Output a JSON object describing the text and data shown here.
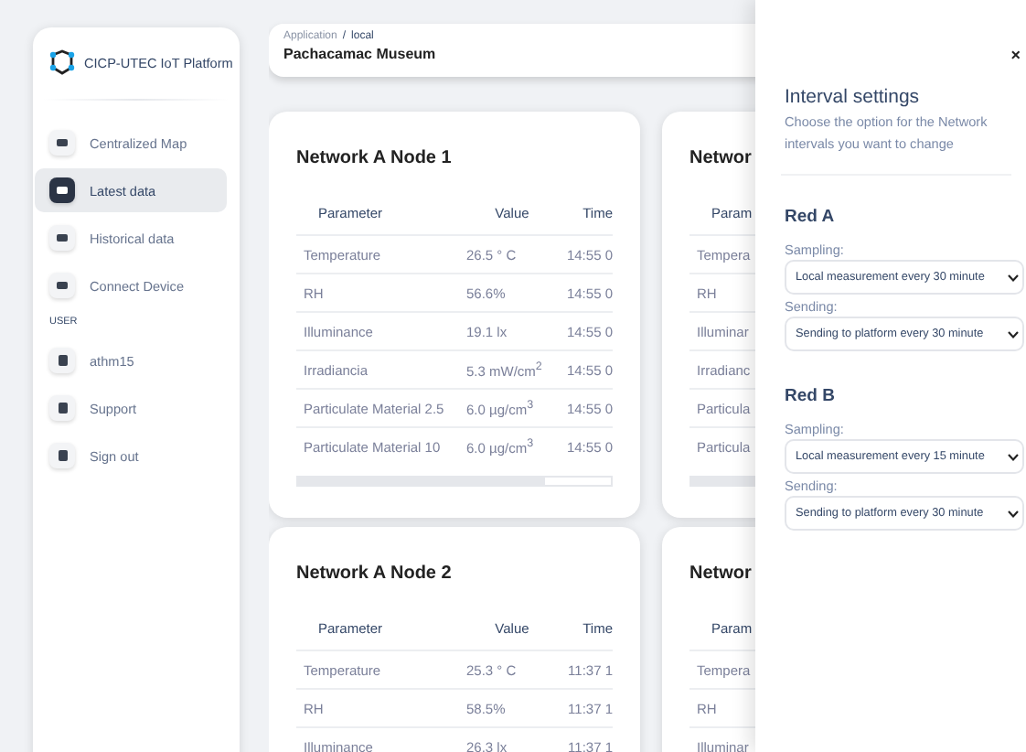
{
  "sidebar": {
    "logo": "CICP-UTEC IoT Platform",
    "nav": [
      {
        "label": "Centralized Map",
        "selected": false
      },
      {
        "label": "Latest data",
        "selected": true
      },
      {
        "label": "Historical data",
        "selected": false
      },
      {
        "label": "Connect Device",
        "selected": false
      }
    ],
    "section_label": "USER",
    "user_items": [
      {
        "label": "athm15"
      },
      {
        "label": "Support"
      },
      {
        "label": "Sign out"
      }
    ]
  },
  "breadcrumb": {
    "path": [
      "Application",
      "local"
    ],
    "separator": "/",
    "title": "Pachacamac Museum"
  },
  "cards": [
    {
      "title": "Network A Node 1",
      "columns": [
        "Parameter",
        "Value",
        "Time"
      ],
      "rows": [
        [
          "Temperature",
          "26.5 ° C",
          "14:55 0"
        ],
        [
          "RH",
          "56.6%",
          "14:55 0"
        ],
        [
          "Illuminance",
          "19.1 lx",
          "14:55 0"
        ],
        [
          "Irradiancia",
          "5.3 mW/cm$^{2}$",
          "14:55 0"
        ],
        [
          "Particulate Material 2.5",
          "6.0 µg/cm$^{3}$",
          "14:55 0"
        ],
        [
          "Particulate Material 10",
          "6.0 µg/cm$^{3}$",
          "14:55 0"
        ]
      ],
      "scrollbar": true
    },
    {
      "title": "Networ",
      "columns": [
        "Param"
      ],
      "rows": [
        [
          "Tempera"
        ],
        [
          "RH"
        ],
        [
          "Illuminar"
        ],
        [
          "Irradianc"
        ],
        [
          "Particula"
        ],
        [
          "Particula"
        ]
      ],
      "scrollbar": true
    },
    {
      "title": "Network A Node 2",
      "columns": [
        "Parameter",
        "Value",
        "Time"
      ],
      "rows": [
        [
          "Temperature",
          "25.3 ° C",
          "11:37 1"
        ],
        [
          "RH",
          "58.5%",
          "11:37 1"
        ],
        [
          "Illuminance",
          "26.3 lx",
          "11:37 1"
        ]
      ]
    },
    {
      "title": "Networ",
      "columns": [
        "Param"
      ],
      "rows": [
        [
          "Tempera"
        ],
        [
          "RH"
        ],
        [
          "Illuminar"
        ]
      ]
    }
  ],
  "panel": {
    "close": "×",
    "title": "Interval settings",
    "description": "Choose the option for the Network intervals you want to change",
    "groups": [
      {
        "name": "Red A",
        "fields": [
          {
            "label": "Sampling:",
            "value": "Local measurement every 30 minute"
          },
          {
            "label": "Sending:",
            "value": "Sending to platform every 30 minute"
          }
        ]
      },
      {
        "name": "Red B",
        "fields": [
          {
            "label": "Sampling:",
            "value": "Local measurement every 15 minute"
          },
          {
            "label": "Sending:",
            "value": "Sending to platform every 30 minute"
          }
        ]
      }
    ]
  }
}
